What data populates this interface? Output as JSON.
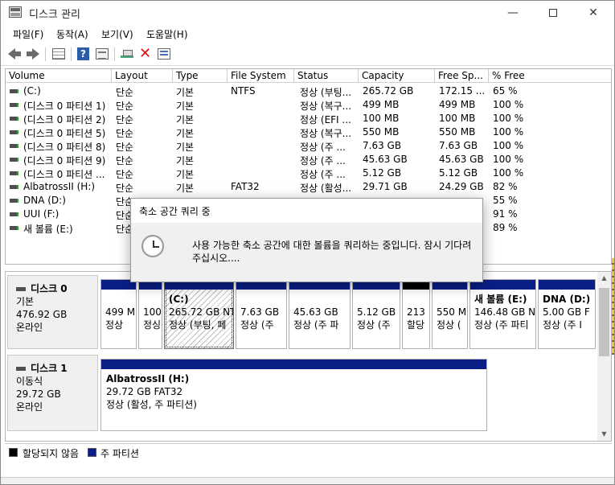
{
  "window": {
    "title": "디스크 관리",
    "minimize_glyph": "—",
    "close_glyph": "✕"
  },
  "menu": {
    "items": [
      "파일(F)",
      "동작(A)",
      "보기(V)",
      "도움말(H)"
    ]
  },
  "toolbar": {
    "icons": [
      "back-icon",
      "forward-icon",
      "disk-list-icon",
      "help-icon",
      "properties-icon",
      "connect-disk-icon",
      "delete-icon",
      "view-icon"
    ],
    "help_glyph": "?",
    "delete_glyph": "✕"
  },
  "volume_list": {
    "columns": [
      "Volume",
      "Layout",
      "Type",
      "File System",
      "Status",
      "Capacity",
      "Free Sp...",
      "% Free"
    ],
    "rows": [
      {
        "volume": "(C:)",
        "layout": "단순",
        "type": "기본",
        "fs": "NTFS",
        "status": "정상 (부팅...",
        "capacity": "265.72 GB",
        "free": "172.15 ...",
        "pct": "65 %"
      },
      {
        "volume": "(디스크 0 파티션 1)",
        "layout": "단순",
        "type": "기본",
        "fs": "",
        "status": "정상 (복구...",
        "capacity": "499 MB",
        "free": "499 MB",
        "pct": "100 %"
      },
      {
        "volume": "(디스크 0 파티션 2)",
        "layout": "단순",
        "type": "기본",
        "fs": "",
        "status": "정상 (EFI ...",
        "capacity": "100 MB",
        "free": "100 MB",
        "pct": "100 %"
      },
      {
        "volume": "(디스크 0 파티션 5)",
        "layout": "단순",
        "type": "기본",
        "fs": "",
        "status": "정상 (복구...",
        "capacity": "550 MB",
        "free": "550 MB",
        "pct": "100 %"
      },
      {
        "volume": "(디스크 0 파티션 8)",
        "layout": "단순",
        "type": "기본",
        "fs": "",
        "status": "정상 (주 ...",
        "capacity": "7.63 GB",
        "free": "7.63 GB",
        "pct": "100 %"
      },
      {
        "volume": "(디스크 0 파티션 9)",
        "layout": "단순",
        "type": "기본",
        "fs": "",
        "status": "정상 (주 ...",
        "capacity": "45.63 GB",
        "free": "45.63 GB",
        "pct": "100 %"
      },
      {
        "volume": "(디스크 0 파티션 ...",
        "layout": "단순",
        "type": "기본",
        "fs": "",
        "status": "정상 (주 ...",
        "capacity": "5.12 GB",
        "free": "5.12 GB",
        "pct": "100 %"
      },
      {
        "volume": "AlbatrossII (H:)",
        "layout": "단순",
        "type": "기본",
        "fs": "FAT32",
        "status": "정상 (활성...",
        "capacity": "29.71 GB",
        "free": "24.29 GB",
        "pct": "82 %"
      },
      {
        "volume": "DNA (D:)",
        "layout": "단순",
        "type": "",
        "fs": "",
        "status": "",
        "capacity": "",
        "free": "",
        "pct": "55 %"
      },
      {
        "volume": "UUI (F:)",
        "layout": "단순",
        "type": "",
        "fs": "",
        "status": "",
        "capacity": "",
        "free": "",
        "pct": "91 %"
      },
      {
        "volume": "새 볼륨 (E:)",
        "layout": "단순",
        "type": "",
        "fs": "",
        "status": "",
        "capacity": "",
        "free": "",
        "pct": "89 %"
      }
    ]
  },
  "disks": [
    {
      "name": "디스크 0",
      "kind": "기본",
      "size": "476.92 GB",
      "state": "온라인",
      "partitions": [
        {
          "name": "",
          "line1": "499 M",
          "line2": "정상"
        },
        {
          "name": "",
          "line1": "100",
          "line2": "정싱"
        },
        {
          "name": "(C:)",
          "line1": "265.72 GB NT",
          "line2": "정상 (부팅, 페"
        },
        {
          "name": "",
          "line1": "7.63 GB",
          "line2": "정상 (주"
        },
        {
          "name": "",
          "line1": "45.63 GB",
          "line2": "정상 (주 파"
        },
        {
          "name": "",
          "line1": "5.12 GB",
          "line2": "정상 (주"
        },
        {
          "name": "",
          "line1": "213",
          "line2": "할당"
        },
        {
          "name": "",
          "line1": "550 M",
          "line2": "정상 ("
        },
        {
          "name": "새 볼륨  (E:)",
          "line1": "146.48 GB N",
          "line2": "정상 (주 파티"
        },
        {
          "name": "DNA  (D:)",
          "line1": "5.00 GB F",
          "line2": "정상 (주 I"
        }
      ]
    },
    {
      "name": "디스크 1",
      "kind": "이동식",
      "size": "29.72 GB",
      "state": "온라인",
      "partitions": [
        {
          "name": "AlbatrossII  (H:)",
          "line1": "29.72 GB FAT32",
          "line2": "정상 (활성, 주 파티션)"
        }
      ]
    }
  ],
  "legend": {
    "unallocated": "할당되지 않음",
    "primary": "주 파티션",
    "unallocated_color": "#000000",
    "primary_color": "#0a1e88"
  },
  "scrollbar": {
    "up_glyph": "▲",
    "down_glyph": "▼"
  },
  "dialog": {
    "title": "축소 공간 쿼리 중",
    "message": "사용 가능한 축소 공간에 대한 볼륨을 쿼리하는 중입니다. 잠시 기다려 주십시오....",
    "icon": "clock-icon"
  }
}
